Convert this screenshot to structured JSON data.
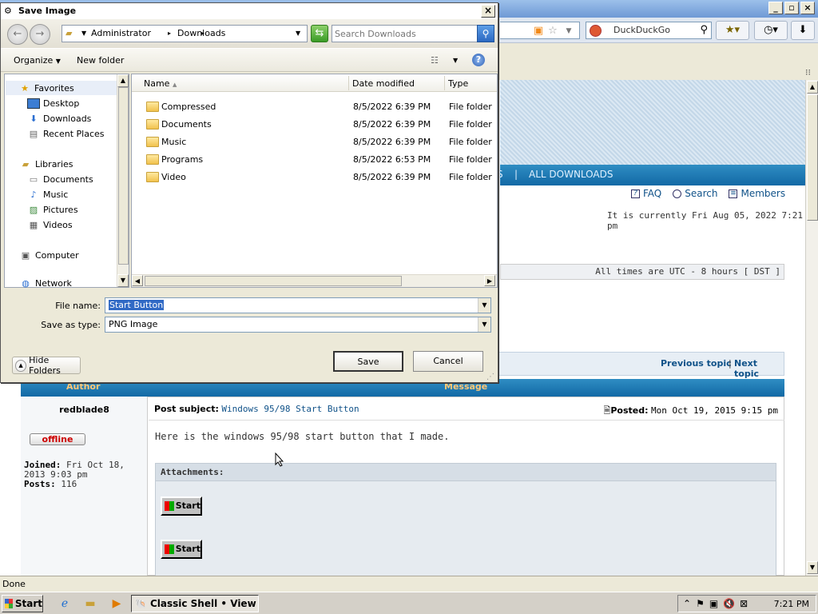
{
  "browser": {
    "search_placeholder": "DuckDuckGo",
    "status": "Done",
    "nav_links": [
      "S",
      "|",
      "ALL DOWNLOADS"
    ],
    "toplinks": {
      "faq": "FAQ",
      "search": "Search",
      "members": "Members"
    },
    "current_time": "It is currently Fri Aug 05, 2022 7:21 pm",
    "timezone": "All times are UTC - 8 hours [ DST ]",
    "topic_nav": {
      "prev": "Previous topic",
      "sep": "|",
      "next": "Next topic"
    },
    "post": {
      "author_header": "Author",
      "message_header": "Message",
      "author": "redblade8",
      "status_badge": "offline",
      "joined_label": "Joined:",
      "joined_value": "Fri Oct 18, 2013 9:03 pm",
      "posts_label": "Posts:",
      "posts_value": "116",
      "subject_label": "Post subject:",
      "subject": "Windows 95/98 Start Button",
      "posted_label": "Posted:",
      "posted_value": "Mon Oct 19, 2015 9:15 pm",
      "body": "Here is the windows 95/98 start button that I made.",
      "attachments_title": "Attachments:",
      "attachment_labels": [
        "Start",
        "Start"
      ]
    }
  },
  "taskbar": {
    "start_label": "Start",
    "task_label": "Classic Shell • View to...",
    "clock": "7:21 PM"
  },
  "dialog": {
    "title": "Save Image",
    "breadcrumb": [
      "Administrator",
      "Downloads"
    ],
    "search_placeholder": "Search Downloads",
    "commands": {
      "organize": "Organize",
      "new_folder": "New folder"
    },
    "nav_items": {
      "favorites": "Favorites",
      "desktop": "Desktop",
      "downloads": "Downloads",
      "recent": "Recent Places",
      "libraries": "Libraries",
      "documents": "Documents",
      "music": "Music",
      "pictures": "Pictures",
      "videos": "Videos",
      "computer": "Computer",
      "network": "Network"
    },
    "columns": {
      "name": "Name",
      "date": "Date modified",
      "type": "Type"
    },
    "files": [
      {
        "name": "Compressed",
        "date": "8/5/2022 6:39 PM",
        "type": "File folder"
      },
      {
        "name": "Documents",
        "date": "8/5/2022 6:39 PM",
        "type": "File folder"
      },
      {
        "name": "Music",
        "date": "8/5/2022 6:39 PM",
        "type": "File folder"
      },
      {
        "name": "Programs",
        "date": "8/5/2022 6:53 PM",
        "type": "File folder"
      },
      {
        "name": "Video",
        "date": "8/5/2022 6:39 PM",
        "type": "File folder"
      }
    ],
    "file_name_label": "File name:",
    "file_name_value": "Start Button",
    "save_type_label": "Save as type:",
    "save_type_value": "PNG Image",
    "hide_folders": "Hide Folders",
    "save": "Save",
    "cancel": "Cancel"
  }
}
